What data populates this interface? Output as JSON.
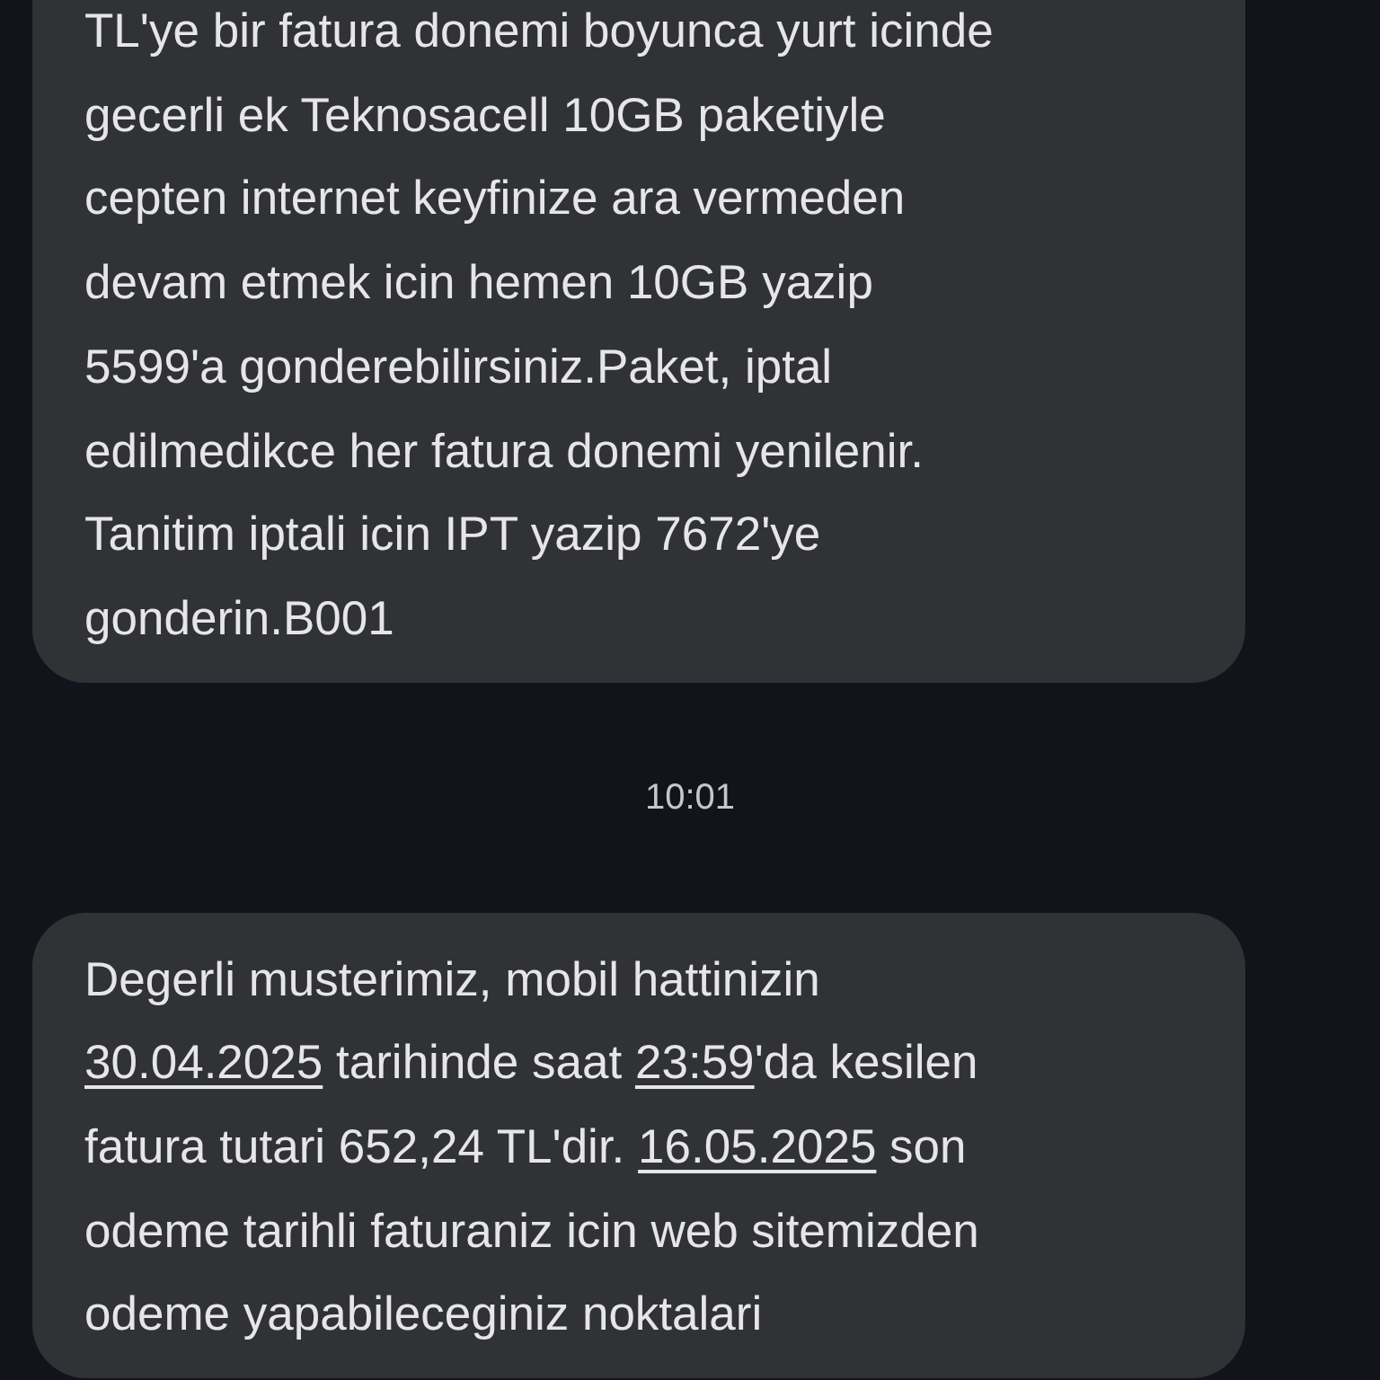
{
  "messages": [
    {
      "kind": "bubble",
      "cut_top": true,
      "segments": [
        {
          "kind": "text",
          "text": "TL'ye bir fatura donemi boyunca yurt icinde\ngecerli ek Teknosacell 10GB paketiyle\ncepten internet keyfinize ara vermeden\ndevam etmek icin hemen 10GB yazip\n5599'a gonderebilirsiniz.Paket, iptal\nedilmedikce her fatura donemi yenilenir.\nTanitim iptali icin IPT yazip 7672'ye\ngonderin.B001"
        }
      ]
    },
    {
      "kind": "time",
      "text": "10:01"
    },
    {
      "kind": "bubble",
      "cut_top": false,
      "segments": [
        {
          "kind": "text",
          "text": "Degerli musterimiz, mobil hattinizin\n"
        },
        {
          "kind": "link",
          "text": "30.04.2025"
        },
        {
          "kind": "text",
          "text": " tarihinde saat "
        },
        {
          "kind": "link",
          "text": "23:59"
        },
        {
          "kind": "text",
          "text": "'da kesilen\nfatura tutari 652,24 TL'dir. "
        },
        {
          "kind": "link",
          "text": "16.05.2025"
        },
        {
          "kind": "text",
          "text": " son\nodeme tarihli faturaniz icin web sitemizden\nodeme yapabileceginiz noktalari"
        }
      ]
    }
  ]
}
